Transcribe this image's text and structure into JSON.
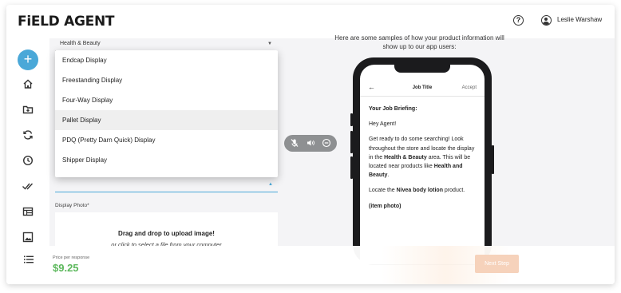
{
  "header": {
    "logo": "FiELD AGENT",
    "help_icon": "question-circle-icon",
    "user_icon": "user-circle-icon",
    "user_name": "Leslie Warshaw"
  },
  "sidebar": {
    "add_label": "+",
    "items": [
      "home-icon",
      "folder-plus-icon",
      "refresh-icon",
      "clock-icon",
      "double-check-icon",
      "table-icon",
      "image-icon"
    ]
  },
  "form": {
    "category_value": "Health & Beauty",
    "display_options": [
      "Endcap Display",
      "Freestanding Display",
      "Four-Way Display",
      "Pallet Display",
      "PDQ (Pretty Darn Quick) Display",
      "Shipper Display"
    ],
    "photo_label": "Display Photo*",
    "upload_main": "Drag and drop to upload image!",
    "upload_sub": "or click to select a file from your computer"
  },
  "controls": [
    "mic-off-icon",
    "volume-icon",
    "minus-circle-icon"
  ],
  "preview": {
    "samples_text": "Here are some samples of how your product information will show up to our app users:",
    "job_title": "Job Title",
    "accept": "Accept",
    "back_icon": "arrow-left-icon",
    "briefing_title": "Your Job Briefing:",
    "greeting": "Hey Agent!",
    "para1_a": "Get ready to do some searching! Look throughout the store and locate the display in the ",
    "para1_b": "Health & Beauty",
    "para1_c": " area. This will be located near products like ",
    "para1_d": "Health and Beauty",
    "para1_e": ".",
    "para2_a": "Locate the ",
    "para2_b": "Nivea body lotion",
    "para2_c": " product.",
    "item_photo": "(item photo)"
  },
  "footer": {
    "list_icon": "list-icon",
    "price_label": "Price per response",
    "price": "$9.25",
    "next_label": "Next Step"
  },
  "colors": {
    "accent_blue": "#4aa8d8",
    "price_green": "#5cb85c",
    "next_disabled": "#f6d2bb"
  }
}
